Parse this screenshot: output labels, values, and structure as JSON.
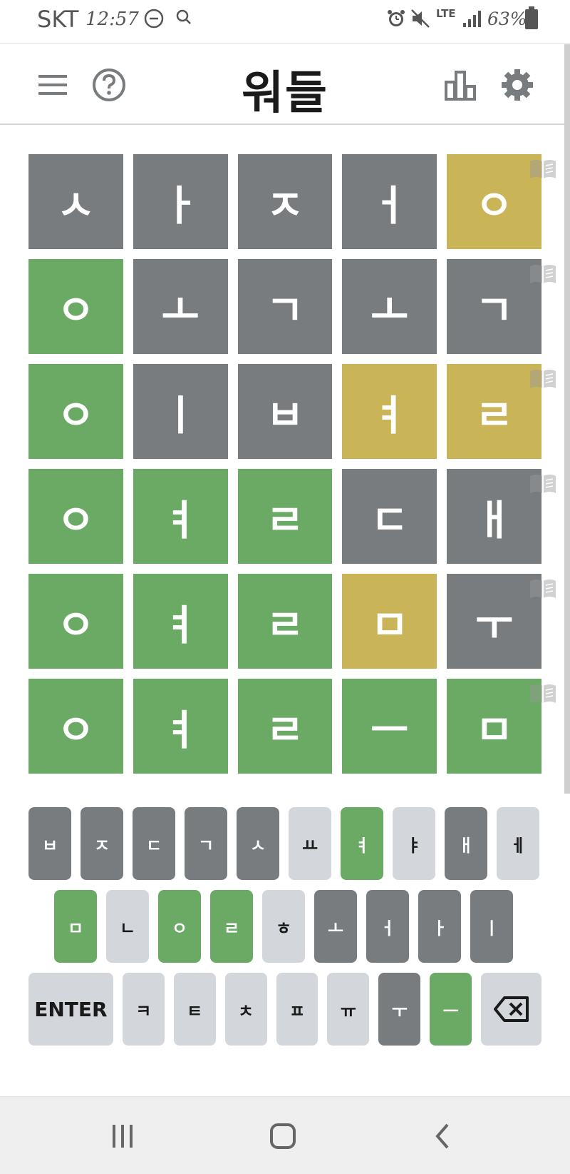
{
  "status_bar": {
    "carrier": "SKT",
    "time": "12:57",
    "network": "LTE",
    "battery": "63%"
  },
  "header": {
    "title": "워들"
  },
  "board": [
    [
      {
        "letter": "ㅅ",
        "state": "gray"
      },
      {
        "letter": "ㅏ",
        "state": "gray"
      },
      {
        "letter": "ㅈ",
        "state": "gray"
      },
      {
        "letter": "ㅓ",
        "state": "gray"
      },
      {
        "letter": "ㅇ",
        "state": "yellow"
      }
    ],
    [
      {
        "letter": "ㅇ",
        "state": "green"
      },
      {
        "letter": "ㅗ",
        "state": "gray"
      },
      {
        "letter": "ㄱ",
        "state": "gray"
      },
      {
        "letter": "ㅗ",
        "state": "gray"
      },
      {
        "letter": "ㄱ",
        "state": "gray"
      }
    ],
    [
      {
        "letter": "ㅇ",
        "state": "green"
      },
      {
        "letter": "ㅣ",
        "state": "gray"
      },
      {
        "letter": "ㅂ",
        "state": "gray"
      },
      {
        "letter": "ㅕ",
        "state": "yellow"
      },
      {
        "letter": "ㄹ",
        "state": "yellow"
      }
    ],
    [
      {
        "letter": "ㅇ",
        "state": "green"
      },
      {
        "letter": "ㅕ",
        "state": "green"
      },
      {
        "letter": "ㄹ",
        "state": "green"
      },
      {
        "letter": "ㄷ",
        "state": "gray"
      },
      {
        "letter": "ㅐ",
        "state": "gray"
      }
    ],
    [
      {
        "letter": "ㅇ",
        "state": "green"
      },
      {
        "letter": "ㅕ",
        "state": "green"
      },
      {
        "letter": "ㄹ",
        "state": "green"
      },
      {
        "letter": "ㅁ",
        "state": "yellow"
      },
      {
        "letter": "ㅜ",
        "state": "gray"
      }
    ],
    [
      {
        "letter": "ㅇ",
        "state": "green"
      },
      {
        "letter": "ㅕ",
        "state": "green"
      },
      {
        "letter": "ㄹ",
        "state": "green"
      },
      {
        "letter": "ㅡ",
        "state": "green"
      },
      {
        "letter": "ㅁ",
        "state": "green"
      }
    ]
  ],
  "keyboard": {
    "row1": [
      {
        "label": "ㅂ",
        "state": "gray"
      },
      {
        "label": "ㅈ",
        "state": "gray"
      },
      {
        "label": "ㄷ",
        "state": "gray"
      },
      {
        "label": "ㄱ",
        "state": "gray"
      },
      {
        "label": "ㅅ",
        "state": "gray"
      },
      {
        "label": "ㅛ",
        "state": "light"
      },
      {
        "label": "ㅕ",
        "state": "green"
      },
      {
        "label": "ㅑ",
        "state": "light"
      },
      {
        "label": "ㅐ",
        "state": "gray"
      },
      {
        "label": "ㅔ",
        "state": "light"
      }
    ],
    "row2": [
      {
        "label": "ㅁ",
        "state": "green"
      },
      {
        "label": "ㄴ",
        "state": "light"
      },
      {
        "label": "ㅇ",
        "state": "green"
      },
      {
        "label": "ㄹ",
        "state": "green"
      },
      {
        "label": "ㅎ",
        "state": "light"
      },
      {
        "label": "ㅗ",
        "state": "gray"
      },
      {
        "label": "ㅓ",
        "state": "gray"
      },
      {
        "label": "ㅏ",
        "state": "gray"
      },
      {
        "label": "ㅣ",
        "state": "gray"
      }
    ],
    "row3": [
      {
        "label": "ENTER",
        "state": "light",
        "kind": "wide"
      },
      {
        "label": "ㅋ",
        "state": "light"
      },
      {
        "label": "ㅌ",
        "state": "light"
      },
      {
        "label": "ㅊ",
        "state": "light"
      },
      {
        "label": "ㅍ",
        "state": "light"
      },
      {
        "label": "ㅠ",
        "state": "light"
      },
      {
        "label": "ㅜ",
        "state": "gray"
      },
      {
        "label": "ㅡ",
        "state": "green"
      },
      {
        "label": "",
        "state": "light",
        "kind": "back",
        "icon": "backspace-icon"
      }
    ]
  },
  "colors": {
    "gray": "#787c7e",
    "green": "#6aaa64",
    "yellow": "#c9b458",
    "light": "#d3d6da"
  },
  "icons": {
    "menu": "hamburger-menu-icon",
    "help": "help-circle-icon",
    "stats": "bar-chart-icon",
    "settings": "gear-icon",
    "definition": "book-icon"
  }
}
